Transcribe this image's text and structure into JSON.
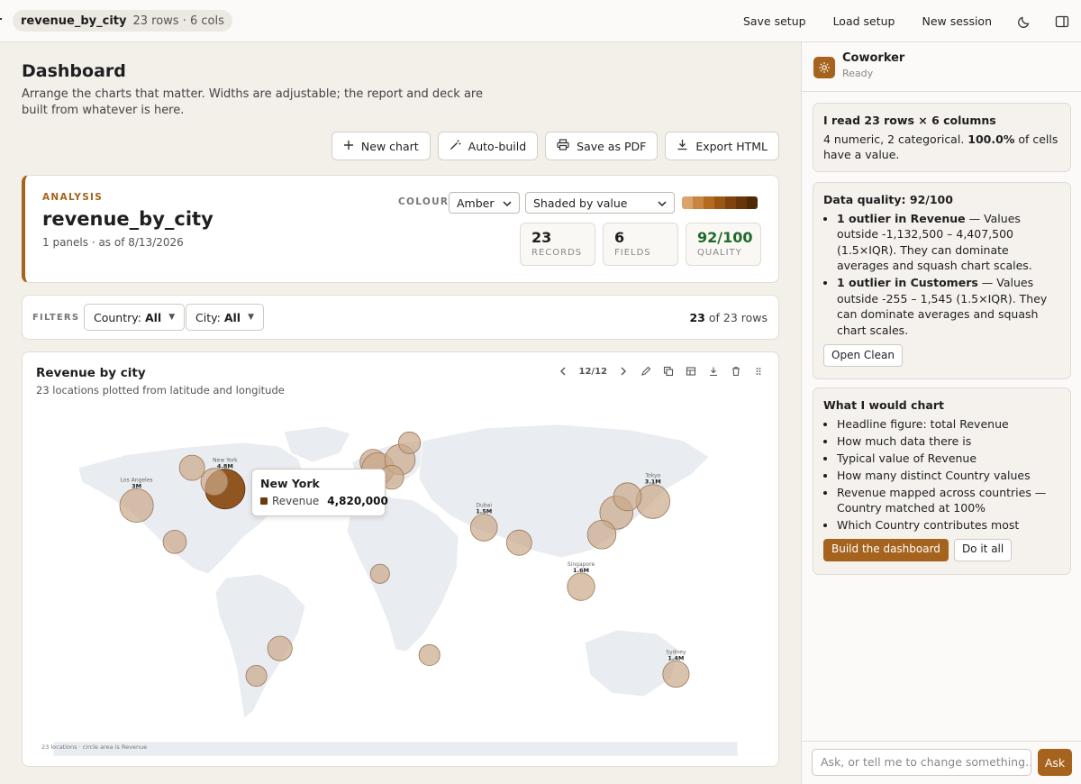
{
  "topbar": {
    "file_name": "revenue_by_city",
    "file_meta": "23 rows · 6 cols",
    "actions": [
      "Save setup",
      "Load setup",
      "New session"
    ],
    "icons": [
      "moon-icon",
      "panel-toggle-icon"
    ]
  },
  "dashboard": {
    "title": "Dashboard",
    "subtitle": "Arrange the charts that matter. Widths are adjustable; the report and deck are built from whatever is here.",
    "actions": [
      {
        "label": "New chart",
        "icon": "plus-icon"
      },
      {
        "label": "Auto-build",
        "icon": "magic-wand-icon"
      },
      {
        "label": "Save as PDF",
        "icon": "printer-icon"
      },
      {
        "label": "Export HTML",
        "icon": "download-icon"
      }
    ]
  },
  "analysis": {
    "tag": "ANALYSIS",
    "name": "revenue_by_city",
    "meta": "1 panels · as of 8/13/2026",
    "colour_label": "COLOUR",
    "palette": "Amber",
    "shading": "Shaded by value",
    "swatches": [
      "#d9a36b",
      "#c8853f",
      "#b46a1f",
      "#9c5614",
      "#80430d",
      "#673509",
      "#4f2806"
    ],
    "stats": [
      {
        "value": "23",
        "label": "RECORDS",
        "color": "#1f1f1f"
      },
      {
        "value": "6",
        "label": "FIELDS",
        "color": "#1f1f1f"
      },
      {
        "value": "92/100",
        "label": "QUALITY",
        "color": "#1e6b2a"
      }
    ]
  },
  "filters": {
    "label": "FILTERS",
    "items": [
      {
        "name": "Country:",
        "value": "All"
      },
      {
        "name": "City:",
        "value": "All"
      }
    ],
    "count_shown": "23",
    "count_rest": "of 23 rows"
  },
  "map_card": {
    "title": "Revenue by city",
    "subtitle": "23 locations plotted from latitude and longitude",
    "page": "12/12",
    "tooltip": {
      "city": "New York",
      "series": "Revenue",
      "value": "4,820,000"
    },
    "footnote": "23 locations · circle area is Revenue",
    "city_labels": [
      {
        "name": "Los Angeles",
        "value": "3M"
      },
      {
        "name": "New York",
        "value": "4.8M"
      },
      {
        "name": "Dubai",
        "value": "1.5M"
      },
      {
        "name": "Tokyo",
        "value": "3.1M"
      },
      {
        "name": "Singapore",
        "value": "1.6M"
      },
      {
        "name": "Sydney",
        "value": "1.4M"
      }
    ]
  },
  "chart_data": {
    "type": "scatter",
    "title": "Revenue by city",
    "subtitle": "23 locations plotted from latitude and longitude",
    "size_field": "Revenue",
    "points": [
      {
        "city": "Los Angeles",
        "lat": 34.05,
        "lon": -118.24,
        "revenue": 3000000,
        "label": true,
        "label_text": "3M"
      },
      {
        "city": "New York",
        "lat": 40.71,
        "lon": -74.0,
        "revenue": 4820000,
        "label": true,
        "label_text": "4.8M",
        "highlight": true
      },
      {
        "city": "Dubai",
        "lat": 25.2,
        "lon": 55.27,
        "revenue": 1500000,
        "label": true,
        "label_text": "1.5M"
      },
      {
        "city": "Tokyo",
        "lat": 35.68,
        "lon": 139.69,
        "revenue": 3100000,
        "label": true,
        "label_text": "3.1M"
      },
      {
        "city": "Singapore",
        "lat": 1.35,
        "lon": 103.82,
        "revenue": 1600000,
        "label": true,
        "label_text": "1.6M"
      },
      {
        "city": "Sydney",
        "lat": -33.87,
        "lon": 151.21,
        "revenue": 1400000,
        "label": true,
        "label_text": "1.4M"
      },
      {
        "lat": 43.65,
        "lon": -79.38,
        "revenue": 1500000
      },
      {
        "lat": 49.28,
        "lon": -90.5,
        "revenue": 1200000
      },
      {
        "lat": 19.43,
        "lon": -99.13,
        "revenue": 900000
      },
      {
        "lat": -23.55,
        "lon": -46.63,
        "revenue": 1100000
      },
      {
        "lat": -34.6,
        "lon": -58.38,
        "revenue": 600000
      },
      {
        "lat": 40.42,
        "lon": -3.7,
        "revenue": 900000
      },
      {
        "lat": 51.51,
        "lon": -0.13,
        "revenue": 1300000
      },
      {
        "lat": 48.86,
        "lon": 2.35,
        "revenue": 2600000
      },
      {
        "lat": 52.52,
        "lon": 13.4,
        "revenue": 2200000
      },
      {
        "lat": 45.46,
        "lon": 9.19,
        "revenue": 1000000
      },
      {
        "lat": 59.33,
        "lon": 18.07,
        "revenue": 700000
      },
      {
        "lat": 6.52,
        "lon": 3.38,
        "revenue": 400000
      },
      {
        "lat": -26.2,
        "lon": 28.05,
        "revenue": 600000
      },
      {
        "lat": 19.08,
        "lon": 72.88,
        "revenue": 1200000
      },
      {
        "lat": 31.23,
        "lon": 121.47,
        "revenue": 2900000
      },
      {
        "lat": 37.57,
        "lon": 126.98,
        "revenue": 1700000
      },
      {
        "lat": 22.32,
        "lon": 114.17,
        "revenue": 1800000
      }
    ]
  },
  "coworker": {
    "name": "Coworker",
    "status": "Ready",
    "read_card": {
      "pre": "I read",
      "rows": "23 rows",
      "times": "×",
      "cols": "6 columns",
      "line2_a": "4 numeric, 2 categorical.",
      "line2_pct": "100.0%",
      "line2_b": "of cells have a value."
    },
    "quality_card": {
      "title": "Data quality: 92/100",
      "items": [
        {
          "bold": "1 outlier in Revenue",
          "text": " — Values outside -1,132,500 – 4,407,500 (1.5×IQR). They can dominate averages and squash chart scales."
        },
        {
          "bold": "1 outlier in Customers",
          "text": " — Values outside -255 – 1,545 (1.5×IQR). They can dominate averages and squash chart scales."
        }
      ],
      "button": "Open Clean"
    },
    "chart_card": {
      "title": "What I would chart",
      "items": [
        "Headline figure: total Revenue",
        "How much data there is",
        "Typical value of Revenue",
        "How many distinct Country values",
        "Revenue mapped across countries — Country matched at 100%",
        "Which Country contributes most"
      ],
      "primary_button": "Build the dashboard",
      "secondary_button": "Do it all"
    },
    "composer": {
      "placeholder": "Ask, or tell me to change something…",
      "send": "Ask"
    }
  }
}
